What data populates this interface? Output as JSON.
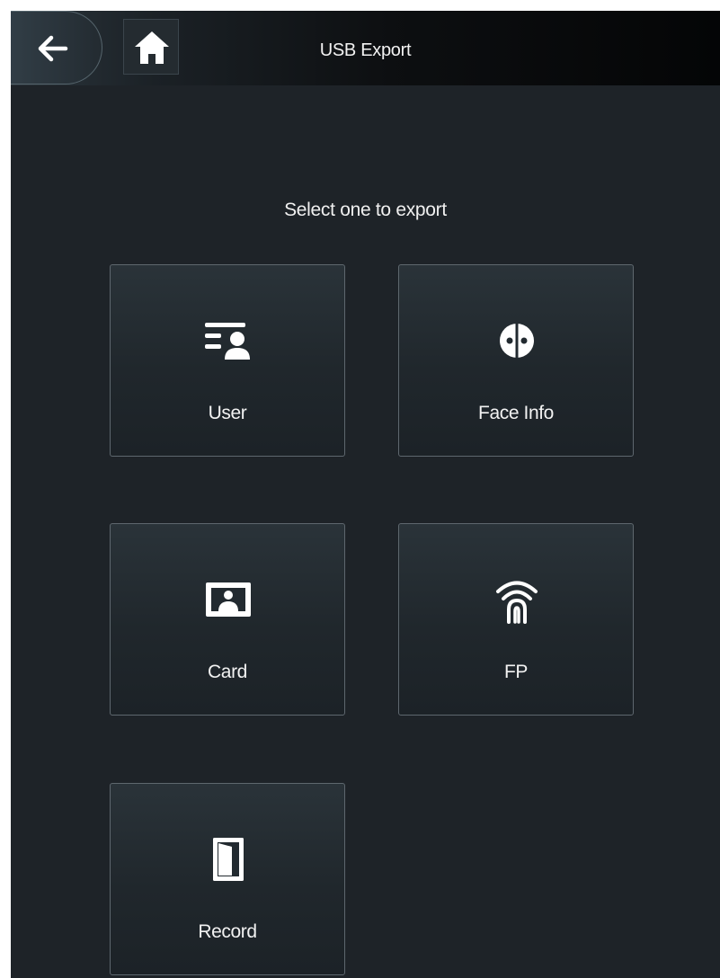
{
  "header": {
    "title": "USB Export",
    "back_icon": "arrow-left-icon",
    "home_icon": "home-icon"
  },
  "main": {
    "prompt": "Select one to export",
    "options": [
      {
        "label": "User",
        "icon": "user-list-icon"
      },
      {
        "label": "Face Info",
        "icon": "face-icon"
      },
      {
        "label": "Card",
        "icon": "card-icon"
      },
      {
        "label": "FP",
        "icon": "fingerprint-icon"
      },
      {
        "label": "Record",
        "icon": "door-record-icon"
      }
    ]
  },
  "colors": {
    "background": "#1e2328",
    "header": "#0d0f11",
    "tile_border": "#5e676e",
    "text": "#f2f2f2"
  }
}
